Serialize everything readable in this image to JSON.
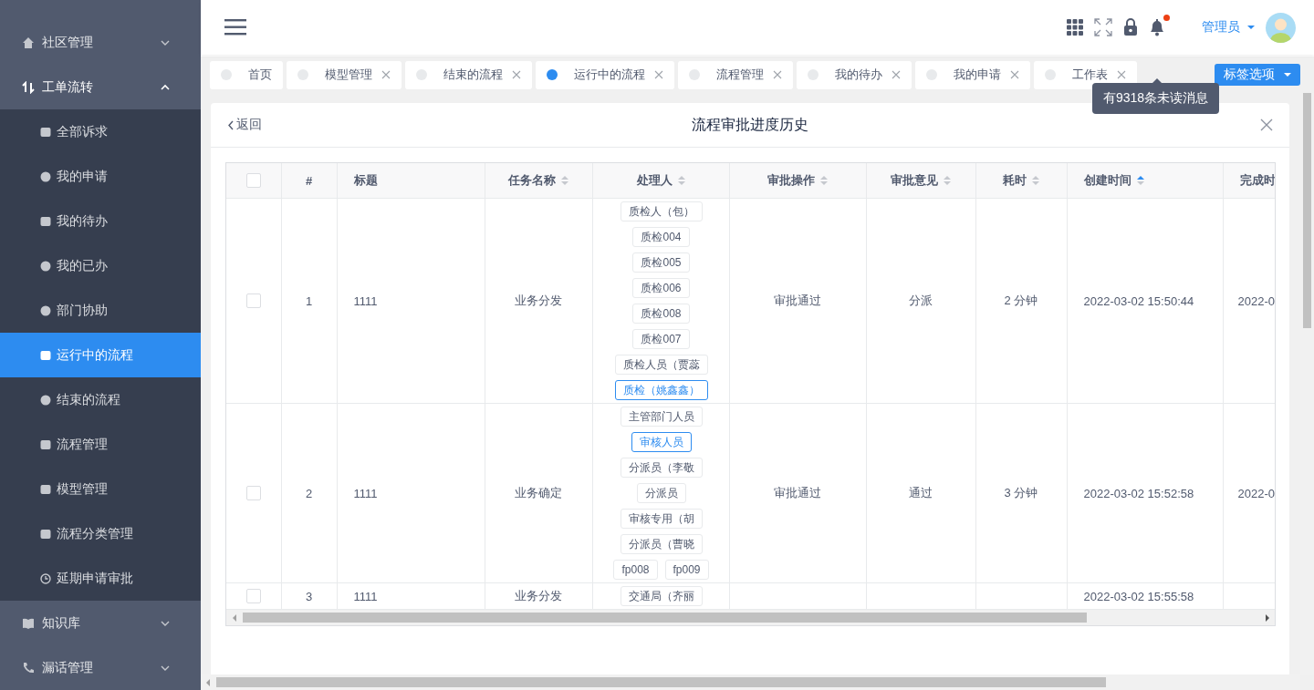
{
  "sidebar": {
    "items": [
      {
        "label": "社区管理",
        "expanded": false
      },
      {
        "label": "工单流转",
        "expanded": true,
        "children": [
          {
            "label": "全部诉求",
            "selected": false
          },
          {
            "label": "我的申请",
            "selected": false
          },
          {
            "label": "我的待办",
            "selected": false
          },
          {
            "label": "我的已办",
            "selected": false
          },
          {
            "label": "部门协助",
            "selected": false
          },
          {
            "label": "运行中的流程",
            "selected": true
          },
          {
            "label": "结束的流程",
            "selected": false
          },
          {
            "label": "流程管理",
            "selected": false
          },
          {
            "label": "模型管理",
            "selected": false
          },
          {
            "label": "流程分类管理",
            "selected": false
          },
          {
            "label": "延期申请审批",
            "selected": false
          }
        ]
      },
      {
        "label": "知识库",
        "expanded": false
      },
      {
        "label": "漏话管理",
        "expanded": false
      }
    ]
  },
  "header": {
    "user": "管理员",
    "notification_tooltip": "有9318条未读消息",
    "has_unread": true
  },
  "tabs": [
    {
      "label": "首页",
      "selected": false,
      "closable": false
    },
    {
      "label": "模型管理",
      "selected": false,
      "closable": true
    },
    {
      "label": "结束的流程",
      "selected": false,
      "closable": true
    },
    {
      "label": "运行中的流程",
      "selected": true,
      "closable": true
    },
    {
      "label": "流程管理",
      "selected": false,
      "closable": true
    },
    {
      "label": "我的待办",
      "selected": false,
      "closable": true
    },
    {
      "label": "我的申请",
      "selected": false,
      "closable": true
    },
    {
      "label": "工作表",
      "selected": false,
      "closable": true
    }
  ],
  "tab_options_button": "标签选项",
  "panel": {
    "back": "返回",
    "title": "流程审批进度历史",
    "table": {
      "columns": [
        {
          "kind": "checkbox",
          "checked": false
        },
        {
          "kind": "text",
          "label": "#",
          "sortable": false
        },
        {
          "kind": "text",
          "label": "标题",
          "sortable": false
        },
        {
          "kind": "text",
          "label": "任务名称",
          "sortable": true,
          "sorted_ascending": false
        },
        {
          "kind": "text",
          "label": "处理人",
          "sortable": true,
          "sorted_ascending": false
        },
        {
          "kind": "text",
          "label": "审批操作",
          "sortable": true,
          "sorted_ascending": false
        },
        {
          "kind": "text",
          "label": "审批意见",
          "sortable": true,
          "sorted_ascending": false
        },
        {
          "kind": "text",
          "label": "耗时",
          "sortable": true,
          "sorted_ascending": false
        },
        {
          "kind": "text",
          "label": "创建时间",
          "sortable": true,
          "sorted_ascending": true
        },
        {
          "kind": "text",
          "label": "完成时",
          "sortable": false
        }
      ],
      "rows": [
        {
          "checked": false,
          "index": "1",
          "title": "1111",
          "task": "业务分发",
          "handlers": [
            {
              "label": "质检人（包）",
              "selected": false
            },
            {
              "label": "质检004",
              "selected": false
            },
            {
              "label": "质检005",
              "selected": false
            },
            {
              "label": "质检006",
              "selected": false
            },
            {
              "label": "质检008",
              "selected": false
            },
            {
              "label": "质检007",
              "selected": false
            },
            {
              "label": "质检人员（贾蕊",
              "selected": false
            },
            {
              "label": "质检（姚鑫鑫）",
              "selected": true
            }
          ],
          "action": "审批通过",
          "opinion": "分派",
          "duration": "2 分钟",
          "created": "2022-03-02 15:50:44",
          "finished": "2022-0"
        },
        {
          "checked": false,
          "index": "2",
          "title": "1111",
          "task": "业务确定",
          "handlers": [
            {
              "label": "主管部门人员",
              "selected": false
            },
            {
              "label": "审核人员",
              "selected": true
            },
            {
              "label": "分派员（李敬",
              "selected": false
            },
            {
              "label": "分派员",
              "selected": false
            },
            {
              "label": "审核专用（胡",
              "selected": false
            },
            {
              "label": "分派员（曹晓",
              "selected": false
            },
            {
              "label": "fp008",
              "selected": false
            },
            {
              "label": "fp009",
              "selected": false
            }
          ],
          "action": "审批通过",
          "opinion": "通过",
          "duration": "3 分钟",
          "created": "2022-03-02 15:52:58",
          "finished": "2022-0"
        },
        {
          "checked": false,
          "index": "3",
          "title": "1111",
          "task": "业务分发",
          "handlers": [
            {
              "label": "交通局（齐丽",
              "selected": false
            }
          ],
          "created": "2022-03-02 15:55:58"
        }
      ]
    }
  }
}
